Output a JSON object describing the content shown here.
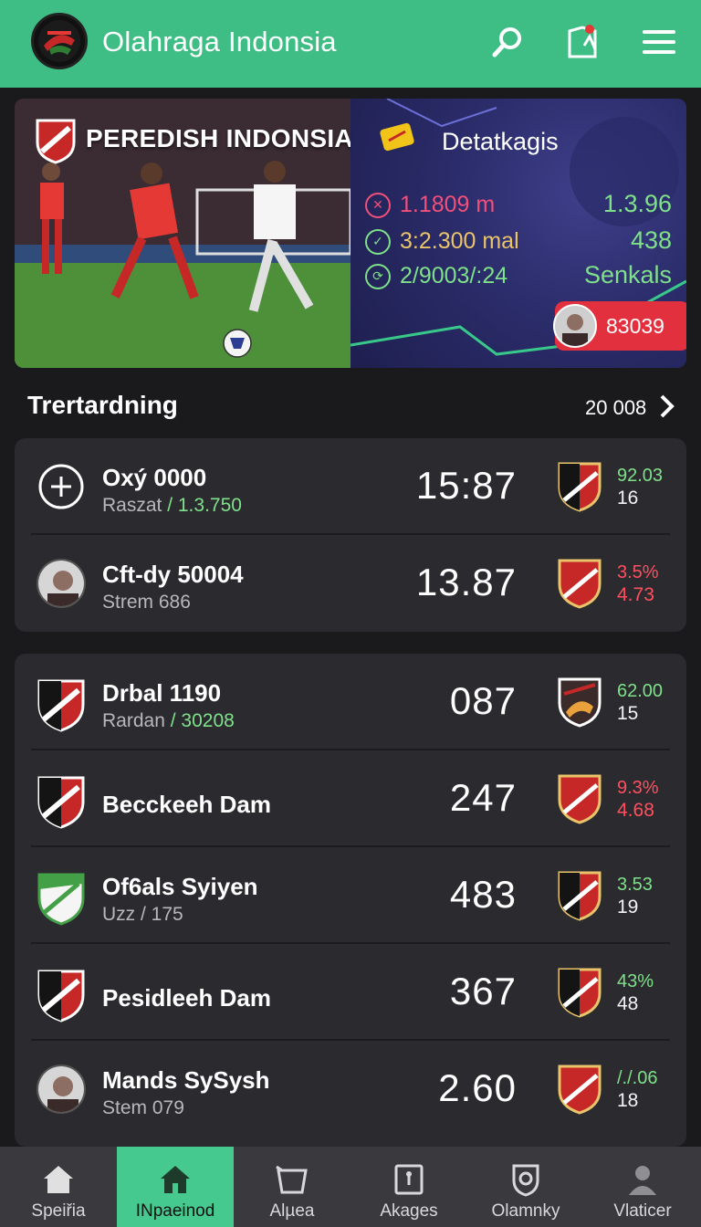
{
  "header": {
    "app_title": "Olahraga Indonsia",
    "icons": [
      "search-icon",
      "player-card-icon",
      "menu-icon"
    ],
    "accent": "#3ebd85"
  },
  "hero": {
    "left_title": "PEREDISH INDONSIA",
    "right_title": "Detatkagis",
    "stats": [
      {
        "icon": "chart-icon",
        "label": "1.1809 m",
        "value": "1.3.96",
        "color": "#f0507a"
      },
      {
        "icon": "clock-icon",
        "label": "3:2.300 mal",
        "value": "438",
        "color": "#e9c46a"
      },
      {
        "icon": "ball-icon",
        "label": "2/9003/:24",
        "value": "Senkals",
        "color": "#7fe08a"
      }
    ],
    "badge_value": "83039"
  },
  "section": {
    "title": "Trertardning",
    "count": "20 008"
  },
  "card1": [
    {
      "icon": "plus-circle-icon",
      "name": "Oxý 0000",
      "sub": "Raszat",
      "sub_hl": "/ 1.3.750",
      "score": "15:87",
      "top": "92.03",
      "bot": "16",
      "top_color": "green",
      "bot_color": "white"
    },
    {
      "icon": "avatar",
      "name": "Cft-dy 50004",
      "sub": "Strem 686",
      "sub_hl": "",
      "score": "13.87",
      "top": "3.5%",
      "bot": "4.73",
      "top_color": "red",
      "bot_color": "red"
    }
  ],
  "card2": [
    {
      "icon": "shield-icon",
      "name": "Drbal 1190",
      "sub": "Rardan",
      "sub_hl": "/ 30208",
      "score": "087",
      "top": "62.00",
      "bot": "15",
      "top_color": "green",
      "bot_color": "white"
    },
    {
      "icon": "shield-icon",
      "name": "Becckeeh Dam",
      "sub": "",
      "sub_hl": "",
      "score": "247",
      "top": "9.3%",
      "bot": "4.68",
      "top_color": "red",
      "bot_color": "red"
    },
    {
      "icon": "shield-green-icon",
      "name": "Of6als Syiyen",
      "sub": "Uzz / 175",
      "sub_hl": "",
      "score": "483",
      "top": "3.53",
      "bot": "19",
      "top_color": "green",
      "bot_color": "white"
    },
    {
      "icon": "shield-icon",
      "name": "Pesidleeh Dam",
      "sub": "",
      "sub_hl": "",
      "score": "367",
      "top": "43%",
      "bot": "48",
      "top_color": "green",
      "bot_color": "white"
    },
    {
      "icon": "avatar",
      "name": "Mands SySysh",
      "sub": "Stem 079",
      "sub_hl": "",
      "score": "2.60",
      "top": "/./.06",
      "bot": "18",
      "top_color": "green",
      "bot_color": "white"
    }
  ],
  "bottom_nav": [
    {
      "icon": "home-icon",
      "label": "Speiřia",
      "active": false
    },
    {
      "icon": "home-icon",
      "label": "INpaeinod",
      "active": true
    },
    {
      "icon": "basket-icon",
      "label": "Alµea",
      "active": false
    },
    {
      "icon": "board-icon",
      "label": "Akages",
      "active": false
    },
    {
      "icon": "badge-icon",
      "label": "Olamnky",
      "active": false
    },
    {
      "icon": "user-icon",
      "label": "Vlaticer",
      "active": false
    }
  ]
}
